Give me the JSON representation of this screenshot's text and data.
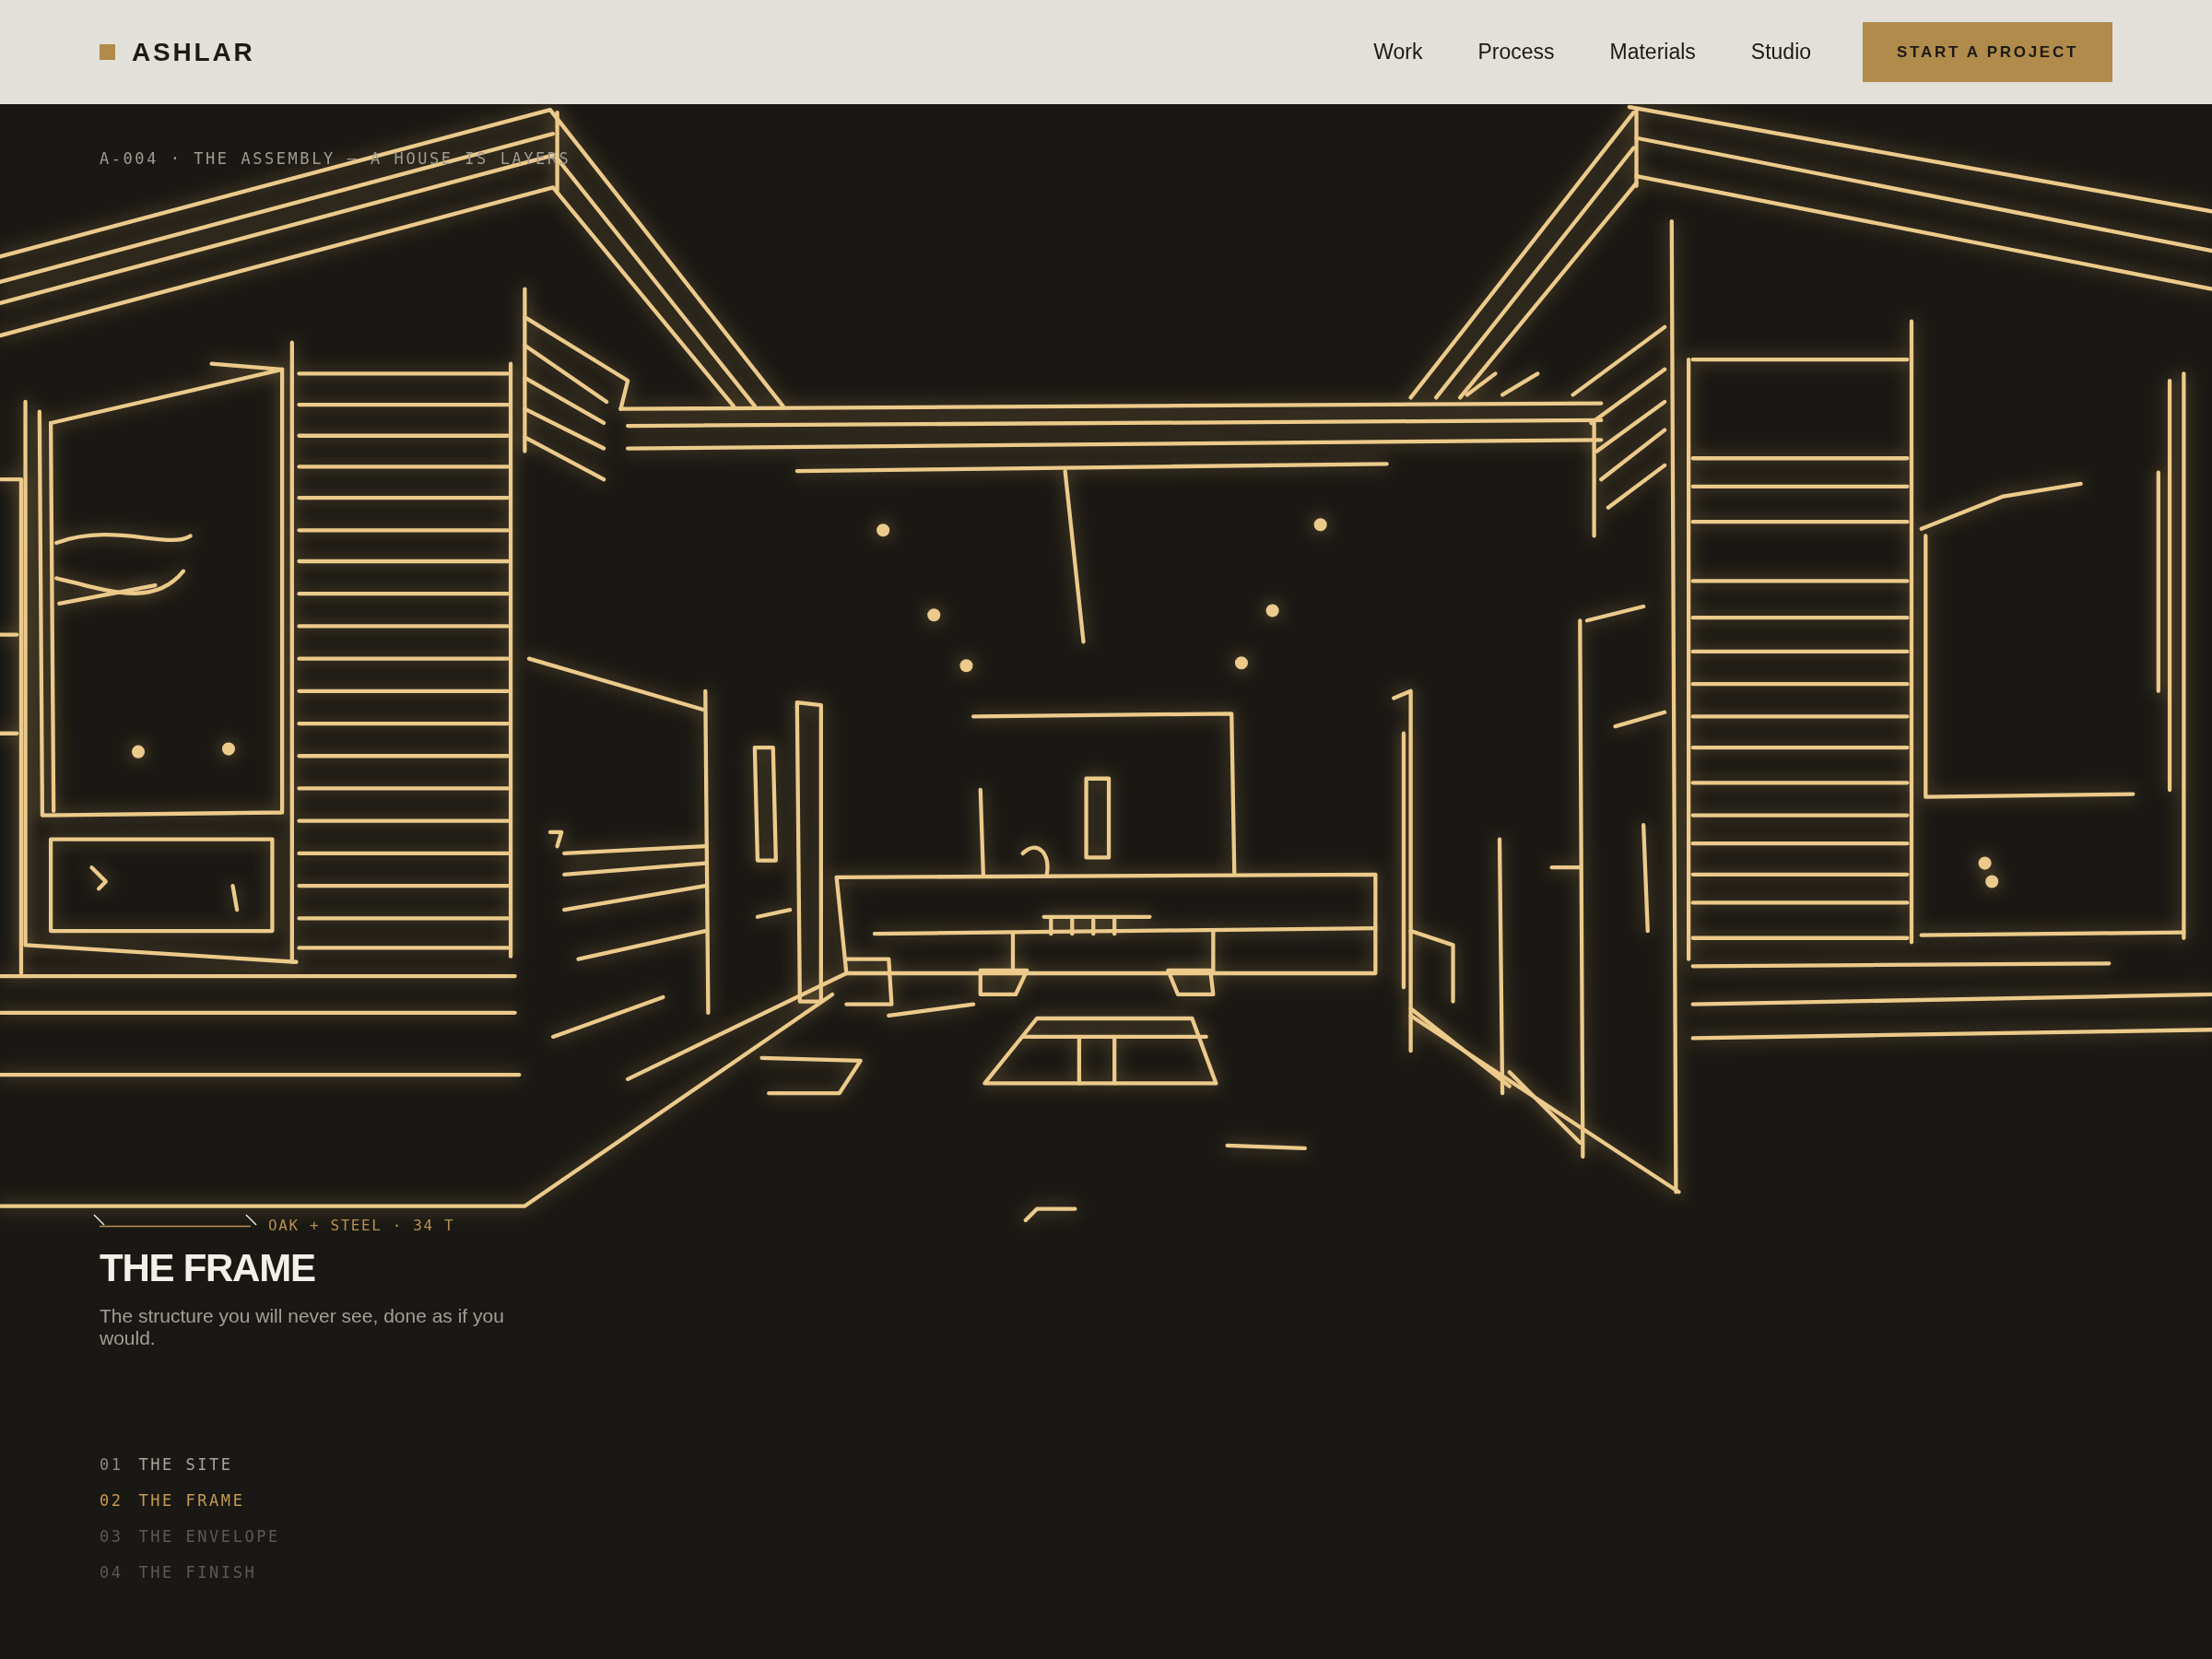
{
  "header": {
    "logo": {
      "text": "ASHLAR"
    },
    "nav": [
      "Work",
      "Process",
      "Materials",
      "Studio"
    ],
    "cta": {
      "label": "START A PROJECT"
    }
  },
  "hero": {
    "caption": "A-004 · THE ASSEMBLY — A HOUSE IS LAYERS",
    "layer": {
      "spec": "OAK + STEEL · 34 T",
      "title": "THE FRAME",
      "description": "The structure you will never see, done as if you would."
    },
    "steps": [
      {
        "number": "01",
        "label": "THE SITE",
        "selected": false,
        "completed": true
      },
      {
        "number": "02",
        "label": "THE FRAME",
        "selected": true,
        "completed": false
      },
      {
        "number": "03",
        "label": "THE ENVELOPE",
        "selected": false,
        "completed": false
      },
      {
        "number": "04",
        "label": "THE FINISH",
        "selected": false,
        "completed": false
      }
    ]
  }
}
